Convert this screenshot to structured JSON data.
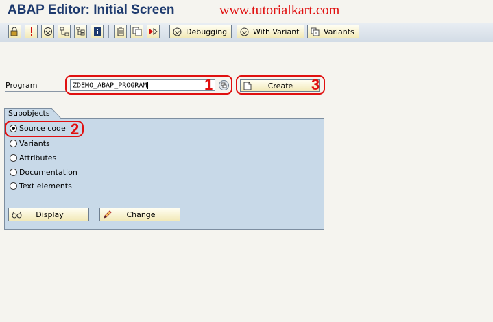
{
  "window": {
    "title": "ABAP Editor: Initial Screen"
  },
  "watermark": "www.tutorialkart.com",
  "toolbar": {
    "icons": [
      "other-object-icon",
      "check-icon",
      "activate-icon",
      "where-used-icon",
      "display-object-list-icon",
      "info-icon",
      "delete-icon",
      "copy-icon",
      "rename-icon"
    ],
    "buttons": [
      {
        "label": "Debugging",
        "icon": "debugging-icon"
      },
      {
        "label": "With Variant",
        "icon": "execute-with-variant-icon"
      },
      {
        "label": "Variants",
        "icon": "variants-icon"
      }
    ]
  },
  "program": {
    "label": "Program",
    "value": "ZDEMO_ABAP_PROGRAM"
  },
  "create": {
    "label": "Create"
  },
  "subobjects": {
    "title": "Subobjects",
    "options": [
      {
        "label": "Source code",
        "selected": true
      },
      {
        "label": "Variants",
        "selected": false
      },
      {
        "label": "Attributes",
        "selected": false
      },
      {
        "label": "Documentation",
        "selected": false
      },
      {
        "label": "Text elements",
        "selected": false
      }
    ]
  },
  "actions": {
    "display": "Display",
    "change": "Change"
  },
  "annotations": {
    "n1": "1",
    "n2": "2",
    "n3": "3"
  },
  "colors": {
    "highlight": "#e01010",
    "title": "#1e3a6e",
    "group_bg": "#c8d9e8"
  }
}
